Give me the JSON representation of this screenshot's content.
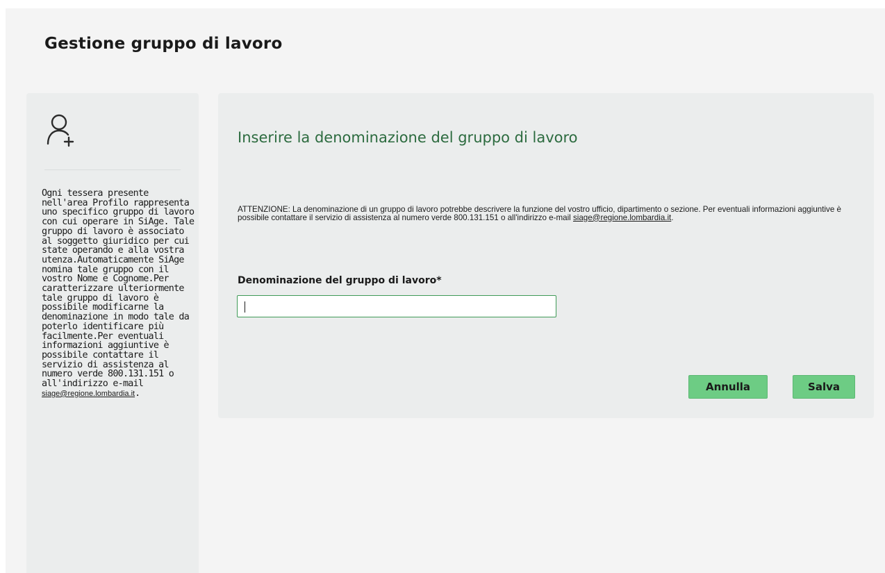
{
  "page": {
    "title": "Gestione gruppo di lavoro"
  },
  "sidebar": {
    "icon": "user-add-icon",
    "description": "Ogni tessera presente nell'area Profilo rappresenta uno specifico gruppo di lavoro con cui operare in SiAge. Tale gruppo di lavoro è associato al soggetto giuridico per cui state operando e alla vostra utenza.Automaticamente SiAge nomina tale gruppo con il vostro Nome e Cognome.Per caratterizzare ulteriormente tale gruppo di lavoro è possibile modificarne la denominazione in modo tale da poterlo identificare più facilmente.Per eventuali informazioni aggiuntive è possibile contattare il servizio di assistenza al numero verde 800.131.151 o all'indirizzo e-mail ",
    "email": "siage@regione.lombardia.it",
    "end": "."
  },
  "main": {
    "section_title": "Inserire la denominazione del gruppo di lavoro",
    "notice": "ATTENZIONE: La denominazione di un gruppo di lavoro potrebbe descrivere la funzione del vostro ufficio, dipartimento o sezione. Per eventuali informazioni aggiuntive è possibile contattare il servizio di assistenza al numero verde 800.131.151 o all'indirizzo e-mail ",
    "notice_email": "siage@regione.lombardia.it",
    "notice_end": ".",
    "field_label": "Denominazione del gruppo di lavoro*",
    "field_value": "",
    "cancel_label": "Annulla",
    "save_label": "Salva"
  },
  "colors": {
    "accent_green": "#6dcc84",
    "title_green": "#2c6b3f",
    "input_border": "#3f9a57",
    "panel_bg": "#ebeded",
    "page_bg": "#f4f4f4"
  }
}
